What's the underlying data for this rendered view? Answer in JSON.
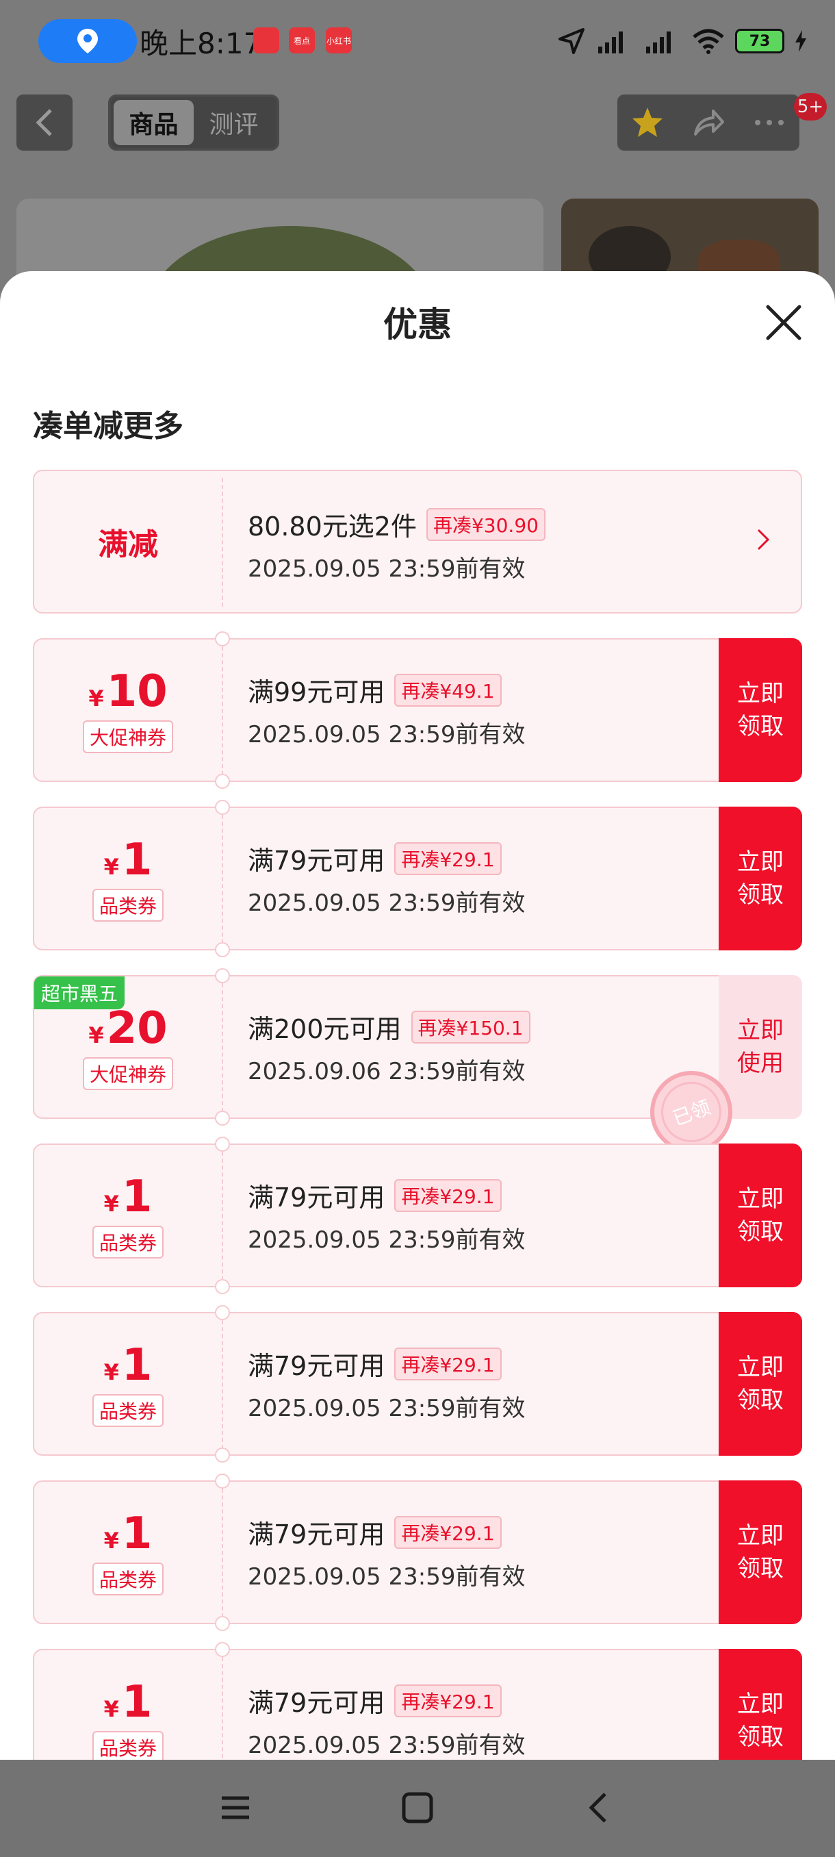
{
  "status_bar": {
    "time": "晚上8:17",
    "app_badges": [
      "",
      "看点",
      "小红书"
    ],
    "battery": "73"
  },
  "header": {
    "tabs": [
      "商品",
      "测评"
    ],
    "badge_count": "5+"
  },
  "sheet": {
    "title": "优惠",
    "section_title": "凑单减更多",
    "manjian": {
      "label": "满减",
      "title": "80.80元选2件",
      "tag": "再凑¥30.90",
      "validity": "2025.09.05 23:59前有效"
    },
    "coupons": [
      {
        "yen": "¥",
        "amount": "10",
        "type": "大促神券",
        "title": "满99元可用",
        "tag": "再凑¥49.1",
        "validity": "2025.09.05 23:59前有效",
        "cta1": "立即",
        "cta2": "领取",
        "corner": "",
        "used": false
      },
      {
        "yen": "¥",
        "amount": "1",
        "type": "品类券",
        "title": "满79元可用",
        "tag": "再凑¥29.1",
        "validity": "2025.09.05 23:59前有效",
        "cta1": "立即",
        "cta2": "领取",
        "corner": "",
        "used": false
      },
      {
        "yen": "¥",
        "amount": "20",
        "type": "大促神券",
        "title": "满200元可用",
        "tag": "再凑¥150.1",
        "validity": "2025.09.06 23:59前有效",
        "cta1": "立即",
        "cta2": "使用",
        "corner": "超市黑五",
        "used": true,
        "stamp": "已领"
      },
      {
        "yen": "¥",
        "amount": "1",
        "type": "品类券",
        "title": "满79元可用",
        "tag": "再凑¥29.1",
        "validity": "2025.09.05 23:59前有效",
        "cta1": "立即",
        "cta2": "领取",
        "corner": "",
        "used": false
      },
      {
        "yen": "¥",
        "amount": "1",
        "type": "品类券",
        "title": "满79元可用",
        "tag": "再凑¥29.1",
        "validity": "2025.09.05 23:59前有效",
        "cta1": "立即",
        "cta2": "领取",
        "corner": "",
        "used": false
      },
      {
        "yen": "¥",
        "amount": "1",
        "type": "品类券",
        "title": "满79元可用",
        "tag": "再凑¥29.1",
        "validity": "2025.09.05 23:59前有效",
        "cta1": "立即",
        "cta2": "领取",
        "corner": "",
        "used": false
      },
      {
        "yen": "¥",
        "amount": "1",
        "type": "品类券",
        "title": "满79元可用",
        "tag": "再凑¥29.1",
        "validity": "2025.09.05 23:59前有效",
        "cta1": "立即",
        "cta2": "领取",
        "corner": "",
        "used": false
      }
    ]
  },
  "colors": {
    "accent_red": "#f0102a",
    "card_bg": "#fdf3f4",
    "tag_green": "#35c14a"
  }
}
